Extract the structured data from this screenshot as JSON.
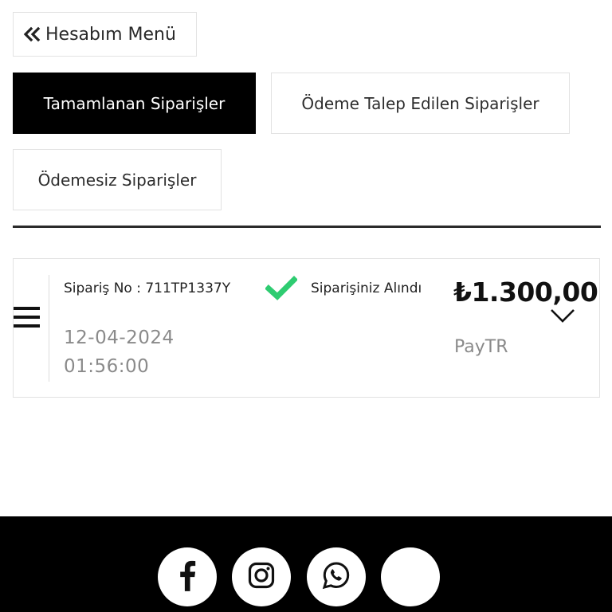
{
  "back_button": {
    "label": "Hesabım Menü",
    "icon": "double-chevron-left-icon"
  },
  "tabs": [
    {
      "label": "Tamamlanan Siparişler",
      "active": true
    },
    {
      "label": "Ödeme Talep Edilen Siparişler",
      "active": false
    },
    {
      "label": "Ödemesiz Siparişler",
      "active": false
    }
  ],
  "order": {
    "order_no": "Sipariş No : 711TP1337Y",
    "date": "12-04-2024",
    "time": "01:56:00",
    "status": "Siparişiniz Alındı",
    "status_icon": "check-icon",
    "status_color": "#2ecc71",
    "price": "₺1.300,00",
    "payment_method": "PayTR"
  },
  "footer": {
    "social": [
      {
        "name": "facebook-icon"
      },
      {
        "name": "instagram-icon"
      },
      {
        "name": "whatsapp-icon"
      },
      {
        "name": "blank-icon"
      }
    ]
  }
}
